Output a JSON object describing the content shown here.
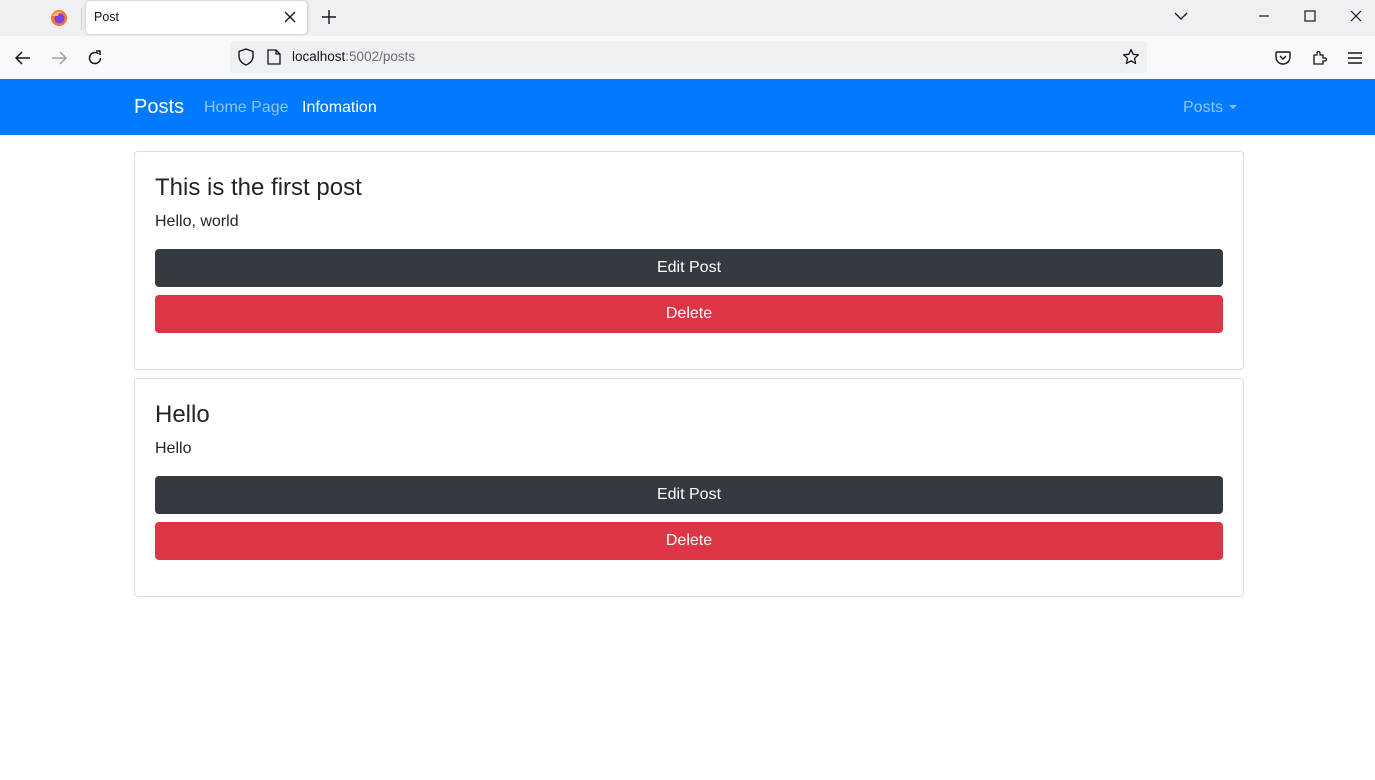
{
  "browser": {
    "tab_title": "Post",
    "url_host": "localhost",
    "url_rest": ":5002/posts"
  },
  "site": {
    "brand": "Posts",
    "nav": {
      "home": "Home Page",
      "info": "Infomation",
      "posts_dropdown": "Posts"
    }
  },
  "posts": [
    {
      "title": "This is the first post",
      "body": "Hello, world",
      "edit_label": "Edit Post",
      "delete_label": "Delete"
    },
    {
      "title": "Hello",
      "body": "Hello",
      "edit_label": "Edit Post",
      "delete_label": "Delete"
    }
  ],
  "colors": {
    "navbar": "#007bff",
    "edit_button": "#343a40",
    "delete_button": "#dc3545"
  }
}
